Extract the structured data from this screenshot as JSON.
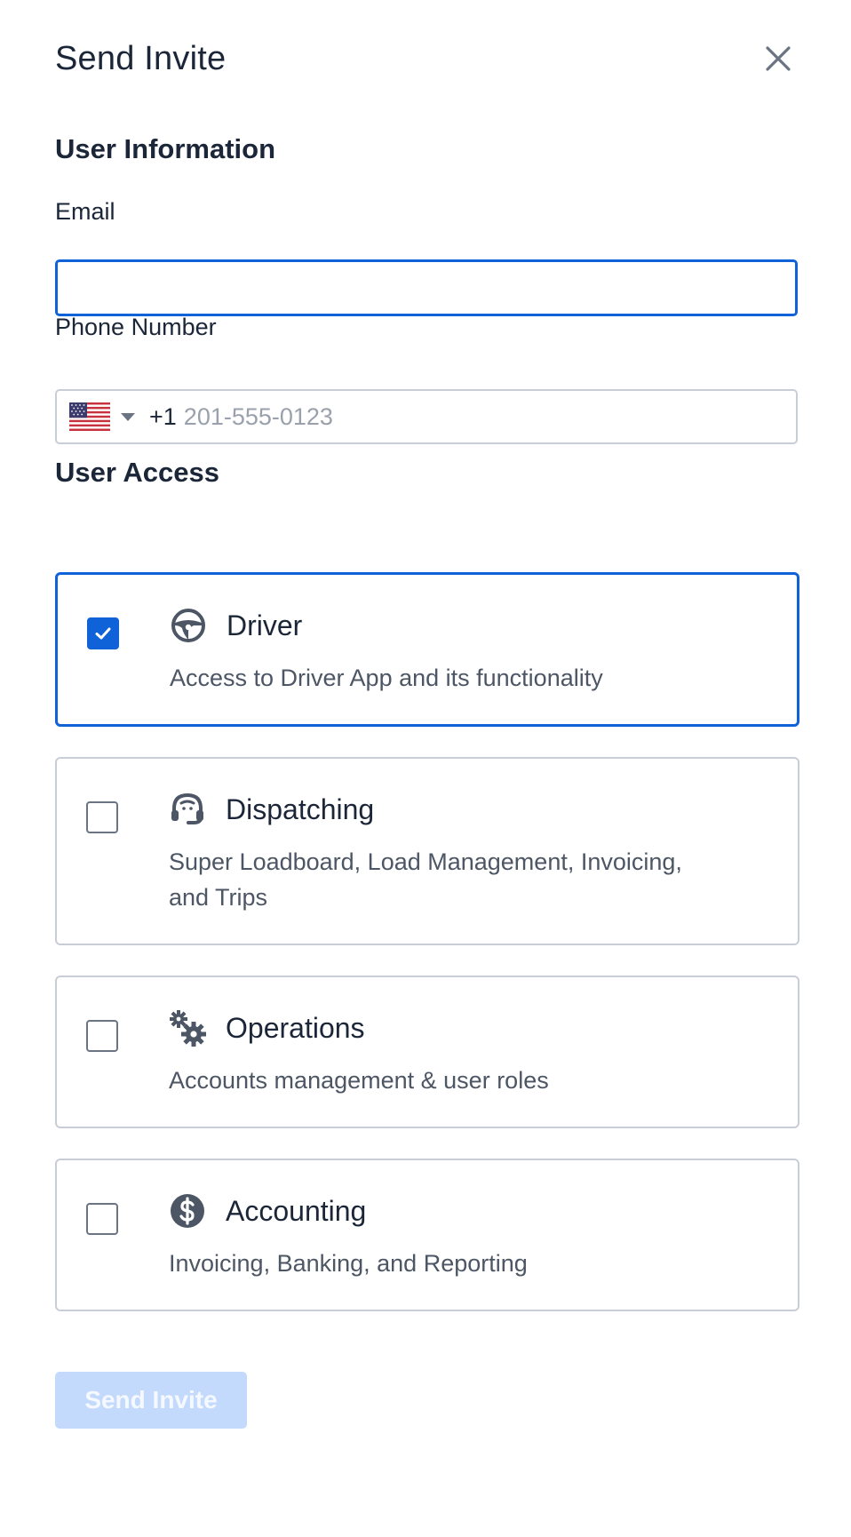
{
  "header": {
    "title": "Send Invite"
  },
  "user_information": {
    "heading": "User Information",
    "email": {
      "label": "Email",
      "value": "",
      "placeholder": ""
    },
    "phone": {
      "label": "Phone Number",
      "country": "US",
      "dial_code": "+1",
      "value": "",
      "placeholder": "201-555-0123"
    }
  },
  "user_access": {
    "heading": "User Access",
    "options": [
      {
        "title": "Driver",
        "description": "Access to Driver App and its functionality",
        "checked": true,
        "icon": "steering-wheel-icon"
      },
      {
        "title": "Dispatching",
        "description": "Super Loadboard, Load Management, Invoicing, and Trips",
        "checked": false,
        "icon": "headset-icon"
      },
      {
        "title": "Operations",
        "description": "Accounts management & user roles",
        "checked": false,
        "icon": "gears-icon"
      },
      {
        "title": "Accounting",
        "description": "Invoicing, Banking, and Reporting",
        "checked": false,
        "icon": "dollar-circle-icon"
      }
    ]
  },
  "footer": {
    "submit_label": "Send Invite",
    "submit_enabled": false
  },
  "colors": {
    "primary": "#0f62d8",
    "primary_disabled": "#c4dafc",
    "border": "#c9ced6",
    "text": "#1b2638",
    "muted_text": "#4d5665"
  }
}
